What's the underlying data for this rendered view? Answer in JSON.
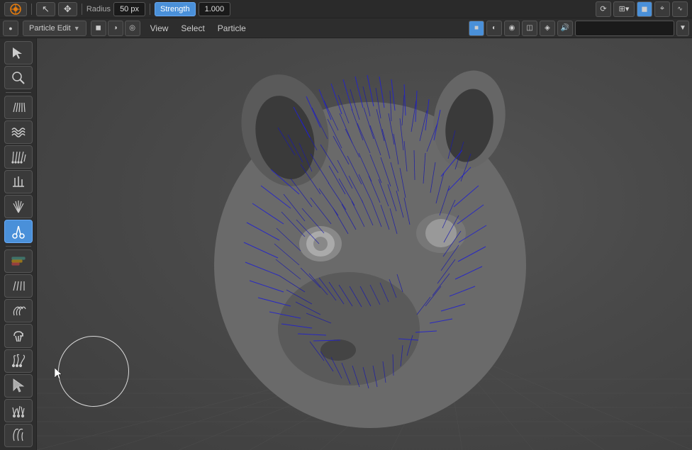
{
  "toolbar": {
    "tool_icon": "⬡",
    "radius_label": "Radius",
    "radius_value": "50 px",
    "strength_label": "Strength",
    "strength_value": "1.000",
    "icons_top_right": [
      "⊞",
      "●",
      "◐",
      "⊙",
      "◈",
      "🔊",
      "⌖",
      "🔍"
    ]
  },
  "menubar": {
    "mode_label": "Particle Edit",
    "menu_items": [
      "View",
      "Select",
      "Particle"
    ],
    "right_icons": [
      "■",
      "▣",
      "◫",
      "◩",
      "◪",
      "🔍"
    ],
    "search_placeholder": ""
  },
  "tools": [
    {
      "id": "select",
      "icon": "↖",
      "active": false,
      "label": "Select"
    },
    {
      "id": "select-circle",
      "icon": "◎",
      "active": false,
      "label": "Select Circle"
    },
    {
      "id": "comb",
      "icon": "|||",
      "active": false,
      "label": "Comb"
    },
    {
      "id": "smooth",
      "icon": "≋",
      "active": false,
      "label": "Smooth"
    },
    {
      "id": "add",
      "icon": "≈",
      "active": false,
      "label": "Add"
    },
    {
      "id": "length",
      "icon": "⏸",
      "active": false,
      "label": "Length"
    },
    {
      "id": "puff",
      "icon": "≋",
      "active": false,
      "label": "Puff"
    },
    {
      "id": "cut",
      "icon": "✂",
      "active": true,
      "label": "Cut"
    },
    {
      "id": "weight",
      "icon": "⣿",
      "active": false,
      "label": "Weight"
    },
    {
      "id": "straighten",
      "icon": "≡",
      "active": false,
      "label": "Straighten"
    },
    {
      "id": "curl",
      "icon": "⌇",
      "active": false,
      "label": "Curl"
    },
    {
      "id": "rotate",
      "icon": "↻",
      "active": false,
      "label": "Rotate"
    },
    {
      "id": "rand",
      "icon": "❋",
      "active": false,
      "label": "Randomize"
    },
    {
      "id": "cursor-tool",
      "icon": "↖",
      "active": false,
      "label": "Cursor"
    },
    {
      "id": "hair-add",
      "icon": "≈",
      "active": false,
      "label": "Add Hair"
    },
    {
      "id": "hair-smooth",
      "icon": "⌇",
      "active": false,
      "label": "Smooth Hair"
    }
  ],
  "scene": {
    "background_color": "#4a4a4a",
    "hair_color": "#1a1a8a",
    "head_color": "#666"
  }
}
